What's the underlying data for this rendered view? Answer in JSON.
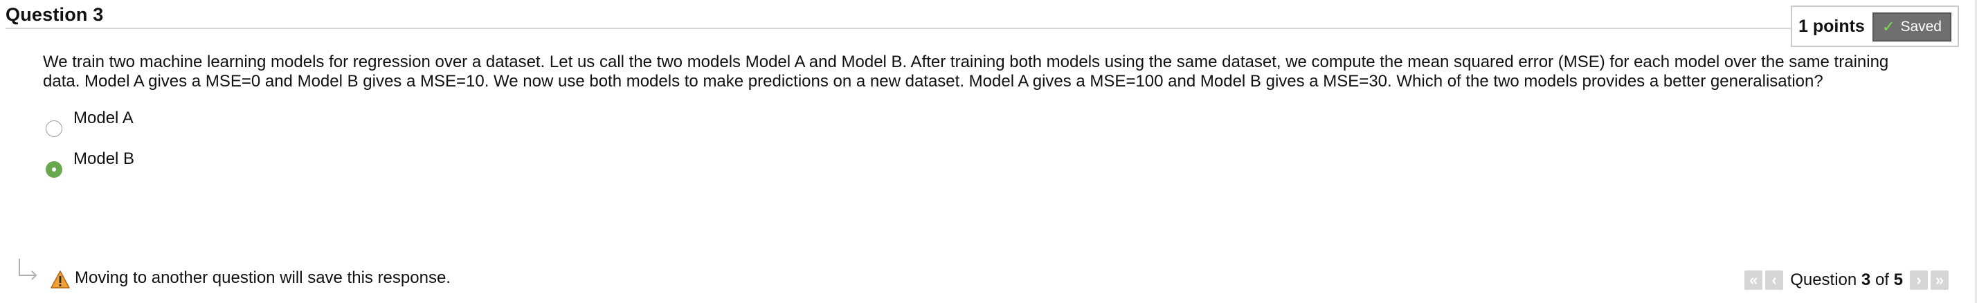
{
  "question": {
    "header": "Question 3",
    "points": "1 points",
    "saved_label": "Saved",
    "text": "We train two machine learning models for regression over a dataset. Let us call the two models Model A and Model B. After training both models using the same dataset, we compute the mean squared error (MSE) for each model over the same training data. Model A gives a MSE=0 and Model B gives a MSE=10. We now use both models to make predictions on a new dataset. Model A gives a MSE=100 and Model B gives a MSE=30. Which of the two models provides a better generalisation?",
    "options": [
      {
        "label": "Model A",
        "selected": false
      },
      {
        "label": "Model B",
        "selected": true
      }
    ]
  },
  "footer": {
    "notice": "Moving to another question will save this response.",
    "pager": {
      "prefix": "Question",
      "current": "3",
      "of": "of",
      "total": "5"
    }
  },
  "colors": {
    "selected_radio": "#6aa84f",
    "saved_badge": "#6f6f6f",
    "check": "#7ed957",
    "warning": "#f0a030"
  },
  "icons": {
    "saved": "check-icon",
    "notice_arrow": "return-arrow-icon",
    "notice_warning": "warning-icon",
    "pager_first": "double-chevron-left-icon",
    "pager_prev": "chevron-left-icon",
    "pager_next": "chevron-right-icon",
    "pager_last": "double-chevron-right-icon"
  }
}
